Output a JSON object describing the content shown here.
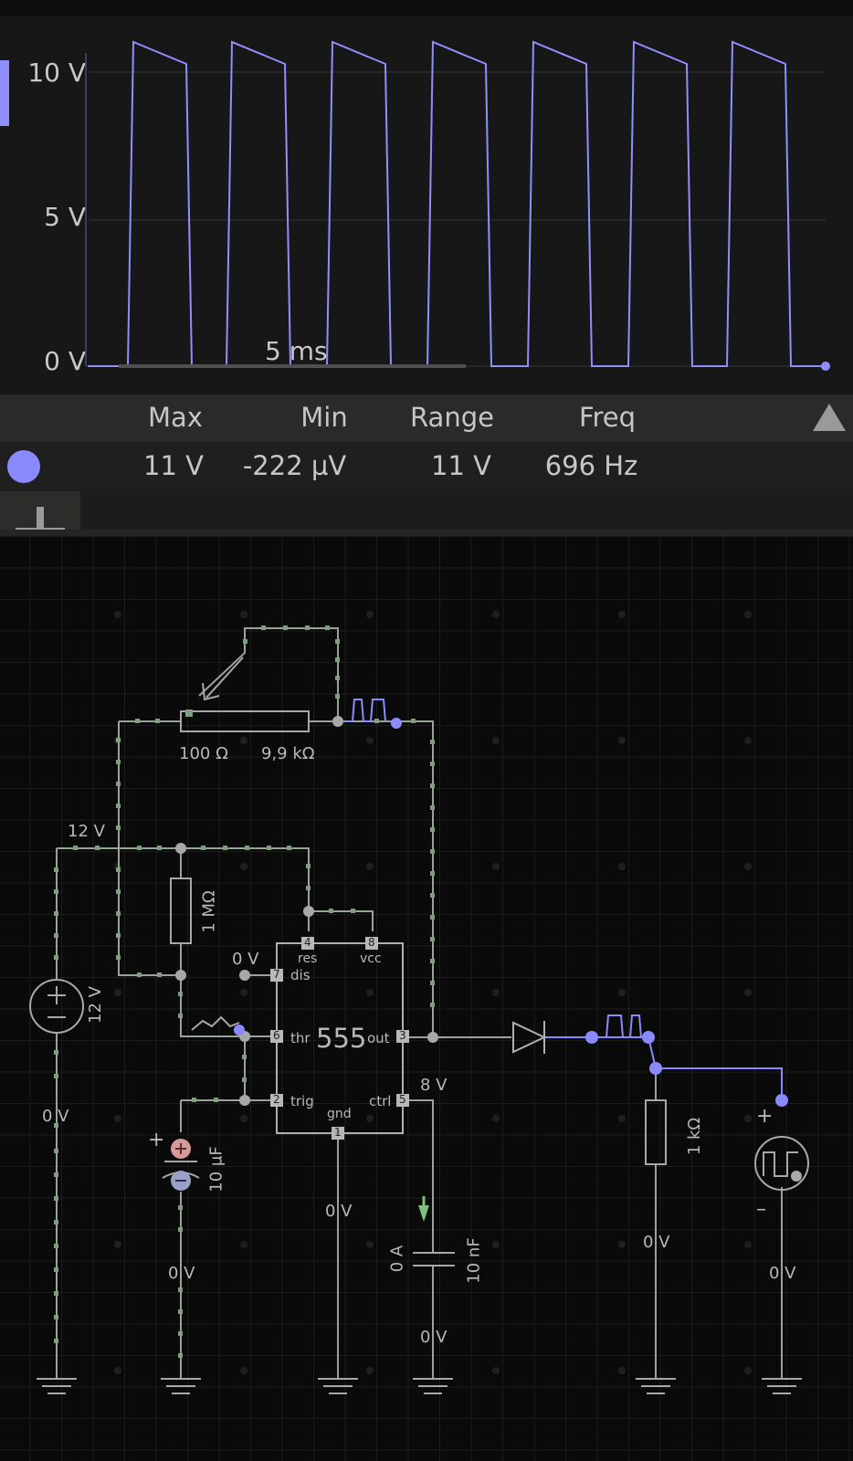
{
  "scope": {
    "y_labels": [
      "10 V",
      "5 V",
      "0 V"
    ],
    "timebase": "5 ms",
    "trace_color": "#8f8fff",
    "stats": {
      "headers": [
        "Max",
        "Min",
        "Range",
        "Freq"
      ],
      "values": [
        "11 V",
        "-222 µV",
        "11 V",
        "696 Hz"
      ]
    }
  },
  "toolbar": {
    "add_icon": "plus-icon",
    "collapse_icon": "triangle-up-icon"
  },
  "circuit": {
    "pot_left": "100 Ω",
    "pot_right": "9,9 kΩ",
    "source_voltage": "12 V",
    "source_label": "12 V",
    "left_rail_node": "0 V",
    "r_timing": "1 MΩ",
    "dis_node": "0 V",
    "cap_value": "10 µF",
    "cap_plus": "+",
    "cap_node_bottom": "0 V",
    "chip_label": "555",
    "pins": {
      "p4": "4",
      "p8": "8",
      "p7": "7",
      "p6": "6",
      "p2": "2",
      "p1": "1",
      "p3": "3",
      "p5": "5",
      "res": "res",
      "vcc": "vcc",
      "dis": "dis",
      "thr": "thr",
      "trig": "trig",
      "gnd": "gnd",
      "out": "out",
      "ctrl": "ctrl"
    },
    "ctrl_node": "8 V",
    "gnd_node": "0 V",
    "ctrl_cap_current": "0 A",
    "ctrl_cap_value": "10 nF",
    "ctrl_cap_node": "0 V",
    "load_resistor": "1 kΩ",
    "load_node": "0 V",
    "generator_plus": "+",
    "generator_minus": "–",
    "generator_node": "0 V"
  }
}
